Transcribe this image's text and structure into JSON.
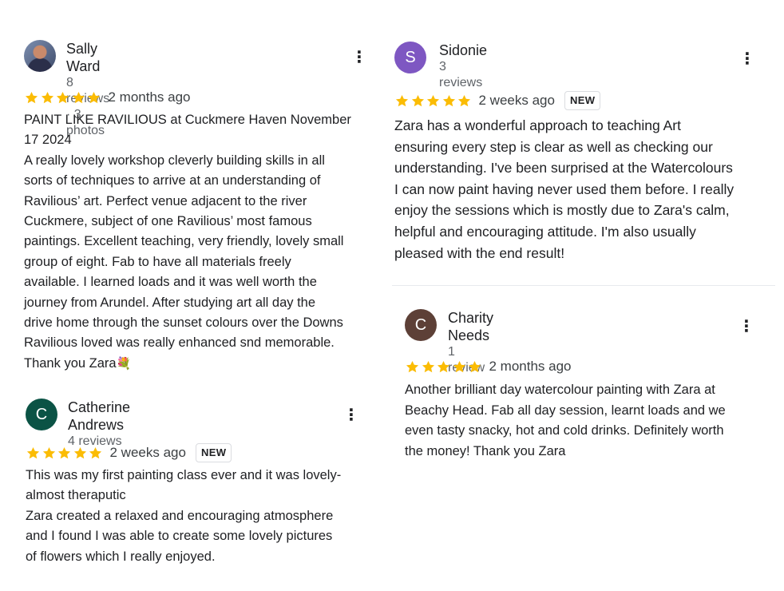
{
  "colors": {
    "star": "#fbbc04",
    "avatar_s": "#7e57c2",
    "avatar_c1": "#0b5345",
    "avatar_c2": "#5d4037",
    "divider": "#e8eaed"
  },
  "icons": {
    "menu": "more-vert-icon",
    "star": "star-icon",
    "flower": "bouquet-emoji"
  },
  "reviews": [
    {
      "name": "Sally Ward",
      "meta": "8 reviews · 3 photos",
      "avatar_letter": "",
      "rating": 5,
      "time": "2 months ago",
      "badge": "",
      "menu": "⋮",
      "lines": [
        "PAINT LIKE RAVILIOUS at Cuckmere Haven November",
        "17 2024",
        "A really lovely workshop cleverly building skills in all",
        "sorts of techniques to arrive at an understanding of",
        "Ravilious’ art. Perfect venue adjacent to the river",
        "Cuckmere, subject of one Ravilious’ most famous",
        "paintings. Excellent teaching, very friendly, lovely small",
        "group of eight. Fab to have all materials freely",
        "available. I learned loads and it was well worth the",
        "journey from Arundel. After studying art all day the",
        "drive home through the sunset colours over the Downs",
        "Ravilious loved was really enhanced snd memorable.",
        "Thank you Zara"
      ],
      "emoji": "💐"
    },
    {
      "name": "Catherine Andrews",
      "meta": "4 reviews",
      "avatar_letter": "C",
      "rating": 5,
      "time": "2 weeks ago",
      "badge": "NEW",
      "menu": "⋮",
      "lines": [
        "This was my first painting class ever and it was lovely-",
        "almost theraputic",
        "Zara created a relaxed and encouraging atmosphere",
        "and I found I was able to create some lovely pictures",
        "of flowers which I really enjoyed."
      ]
    },
    {
      "name": "Sidonie",
      "meta": "3 reviews",
      "avatar_letter": "S",
      "rating": 5,
      "time": "2 weeks ago",
      "badge": "NEW",
      "menu": "⋮",
      "lines": [
        "Zara has a wonderful approach to teaching Art",
        "ensuring every step is clear as well as checking our",
        "understanding. I've been surprised at the Watercolours",
        "I can now paint having never used them before. I really",
        "enjoy the sessions which is mostly due to Zara's calm,",
        "helpful and encouraging attitude. I'm also usually",
        "pleased with the end result!"
      ]
    },
    {
      "name": "Charity Needs",
      "meta": "1 review",
      "avatar_letter": "C",
      "rating": 5,
      "time": "2 months ago",
      "badge": "",
      "menu": "⋮",
      "lines": [
        "Another brilliant day watercolour painting with Zara at",
        "Beachy Head. Fab all day session, learnt loads and we",
        "even tasty snacky, hot and cold drinks. Definitely worth",
        "the money! Thank you Zara"
      ]
    }
  ]
}
